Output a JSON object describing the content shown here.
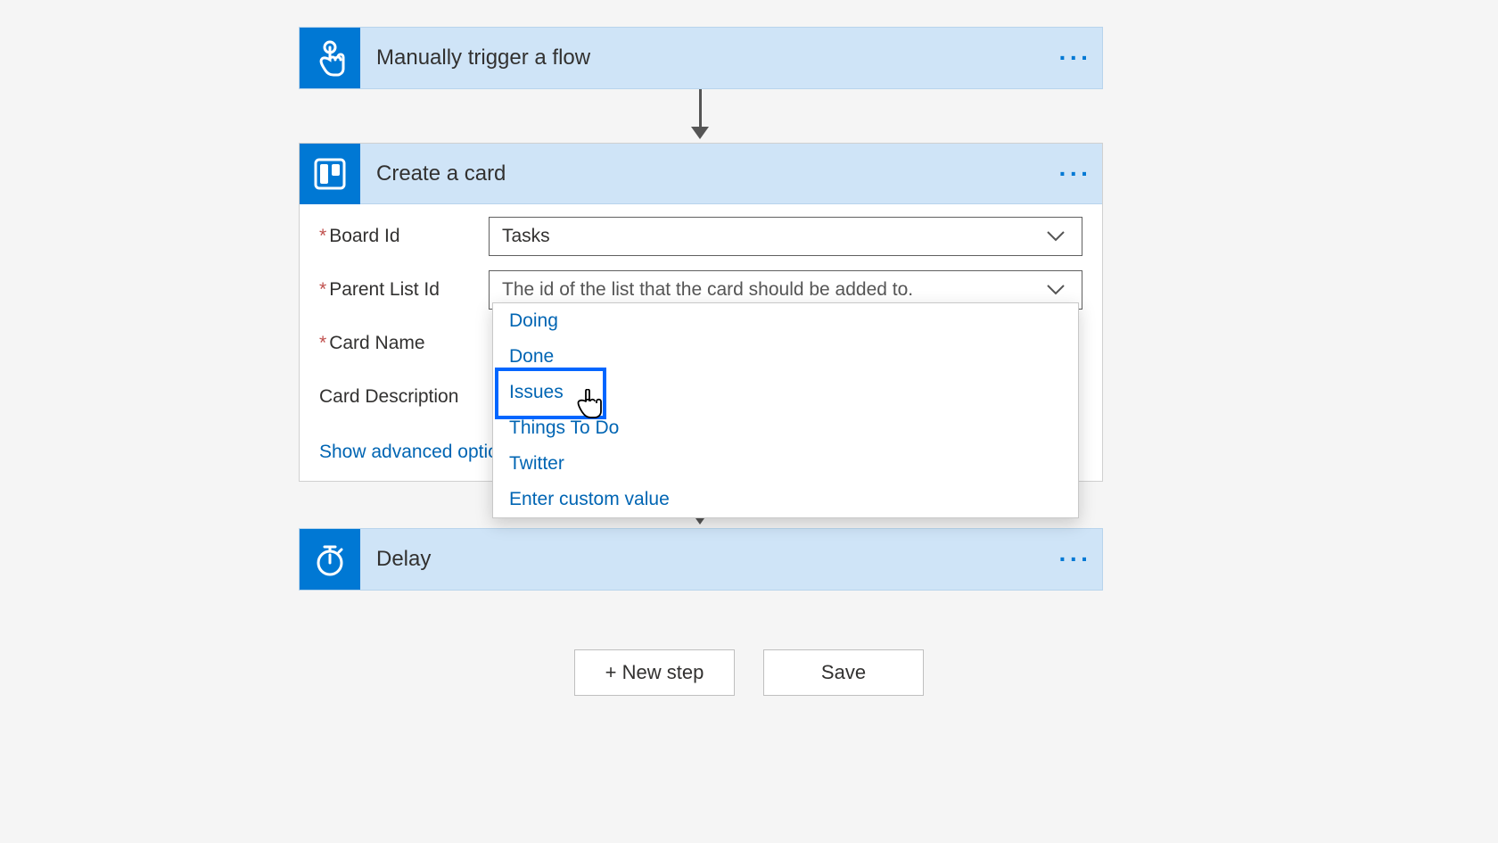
{
  "trigger": {
    "title": "Manually trigger a flow",
    "icon_name": "touch-icon"
  },
  "create_card": {
    "title": "Create a card",
    "icon_name": "trello-icon",
    "fields": {
      "board_id": {
        "label": "Board Id",
        "required": true,
        "value": "Tasks"
      },
      "parent_list_id": {
        "label": "Parent List Id",
        "required": true,
        "placeholder": "The id of the list that the card should be added to."
      },
      "card_name": {
        "label": "Card Name",
        "required": true
      },
      "card_description": {
        "label": "Card Description",
        "required": false
      }
    },
    "advanced_link": "Show advanced options"
  },
  "parent_list_dropdown": {
    "options": [
      "Doing",
      "Done",
      "Issues",
      "Things To Do",
      "Twitter",
      "Enter custom value"
    ],
    "highlighted": "Issues"
  },
  "delay": {
    "title": "Delay",
    "icon_name": "timer-icon"
  },
  "buttons": {
    "new_step": "+ New step",
    "save": "Save"
  },
  "colors": {
    "header_bg": "#cfe4f7",
    "brand_blue": "#0078d4",
    "link_blue": "#0065b3"
  }
}
